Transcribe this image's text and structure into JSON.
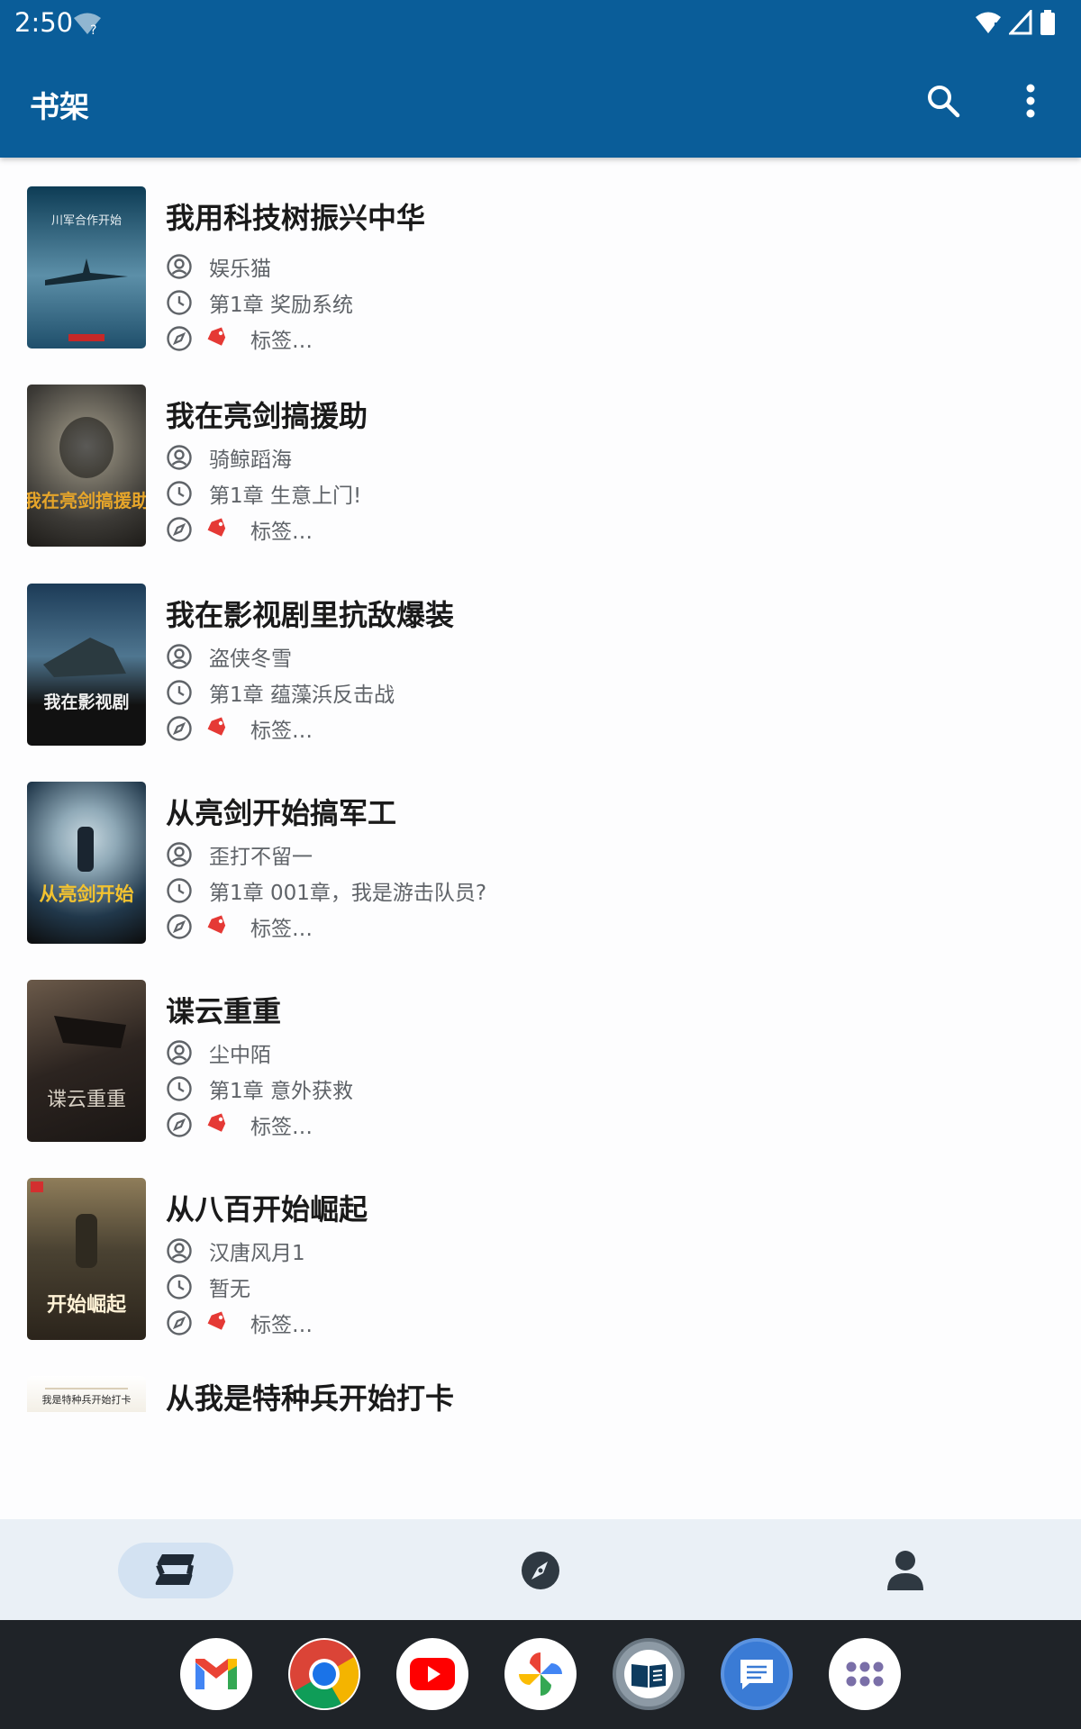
{
  "status_bar": {
    "time": "2:50"
  },
  "app_bar": {
    "title": "书架"
  },
  "books": [
    {
      "title": "我用科技树振兴中华",
      "author": "娱乐猫",
      "latest_chapter": "第1章 奖励系统",
      "tags": "标签…",
      "cover_text": "川军合作开始",
      "cover_colors": [
        "#0d3c55",
        "#5c8fa8",
        "#1f4f6b"
      ]
    },
    {
      "title": "我在亮剑搞援助",
      "author": "骑鲸蹈海",
      "latest_chapter": "第1章 生意上门!",
      "tags": "标签…",
      "cover_text": "我在亮剑搞援助",
      "cover_colors": [
        "#3c3a36",
        "#7d786b",
        "#c88f2b"
      ]
    },
    {
      "title": "我在影视剧里抗敌爆装",
      "author": "盗侠冬雪",
      "latest_chapter": "第1章 蕴藻浜反击战",
      "tags": "标签…",
      "cover_text": "我在影视剧",
      "cover_colors": [
        "#1c3b57",
        "#4f7690",
        "#111111"
      ]
    },
    {
      "title": "从亮剑开始搞军工",
      "author": "歪打不留一",
      "latest_chapter": "第1章 001章，我是游击队员?",
      "tags": "标签…",
      "cover_text": "从亮剑开始",
      "cover_colors": [
        "#21384b",
        "#8fa9b7",
        "#111111"
      ]
    },
    {
      "title": "谍云重重",
      "author": "尘中陌",
      "latest_chapter": "第1章 意外获救",
      "tags": "标签…",
      "cover_text": "谍云重重",
      "cover_colors": [
        "#2c2420",
        "#6b5a4a",
        "#1a1614"
      ]
    },
    {
      "title": "从八百开始崛起",
      "author": "汉唐风月1",
      "latest_chapter": "暂无",
      "tags": "标签…",
      "cover_text": "开始崛起",
      "cover_colors": [
        "#4a4232",
        "#8f7d5a",
        "#2b241b"
      ]
    },
    {
      "title": "从我是特种兵开始打卡",
      "author": "",
      "latest_chapter": "",
      "tags": "",
      "cover_text": "我是特种兵开始打卡",
      "cover_colors": [
        "#f3efe6",
        "#e6dcc6",
        "#ffffff"
      ]
    }
  ],
  "bottom_nav": {
    "items": [
      "bookshelf-icon",
      "explore-icon",
      "profile-icon"
    ],
    "active": 0
  },
  "dock": {
    "apps": [
      "gmail-icon",
      "chrome-icon",
      "youtube-icon",
      "photos-icon",
      "reader-app-icon",
      "messages-icon",
      "app-drawer-icon"
    ]
  },
  "colors": {
    "app_bar": "#0a5d99",
    "tag_icon": "#e53935",
    "nav_active": "#d3e2f2",
    "text_secondary": "#5f6368"
  }
}
